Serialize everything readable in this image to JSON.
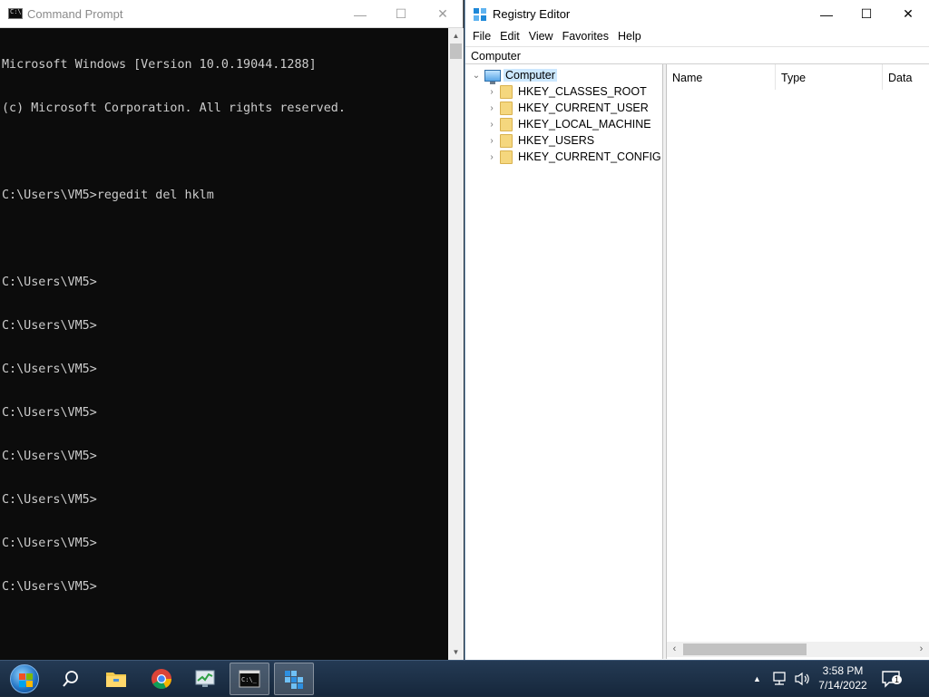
{
  "cmd": {
    "title": "Command Prompt",
    "icon": "cmd-icon",
    "lines": [
      "Microsoft Windows [Version 10.0.19044.1288]",
      "(c) Microsoft Corporation. All rights reserved.",
      "",
      "C:\\Users\\VM5>regedit del hklm",
      "",
      "C:\\Users\\VM5>",
      "C:\\Users\\VM5>",
      "C:\\Users\\VM5>",
      "C:\\Users\\VM5>",
      "C:\\Users\\VM5>",
      "C:\\Users\\VM5>",
      "C:\\Users\\VM5>",
      "C:\\Users\\VM5>"
    ],
    "text_color": "#cccccc",
    "background": "#0c0c0c"
  },
  "regedit": {
    "title": "Registry Editor",
    "icon": "regedit-icon",
    "menu": [
      "File",
      "Edit",
      "View",
      "Favorites",
      "Help"
    ],
    "address": "Computer",
    "tree": {
      "root": "Computer",
      "children": [
        "HKEY_CLASSES_ROOT",
        "HKEY_CURRENT_USER",
        "HKEY_LOCAL_MACHINE",
        "HKEY_USERS",
        "HKEY_CURRENT_CONFIG"
      ]
    },
    "columns": [
      "Name",
      "Type",
      "Data"
    ]
  },
  "window_controls": {
    "minimize": "—",
    "maximize": "☐",
    "close": "✕"
  },
  "taskbar": {
    "items": [
      "start-orb",
      "search-icon",
      "file-explorer-icon",
      "chrome-icon",
      "task-manager-icon",
      "cmd-taskbar-icon",
      "regedit-taskbar-icon"
    ],
    "tray": {
      "show_hidden": "▲",
      "time": "3:58 PM",
      "date": "7/14/2022",
      "notification_count": "1"
    }
  }
}
